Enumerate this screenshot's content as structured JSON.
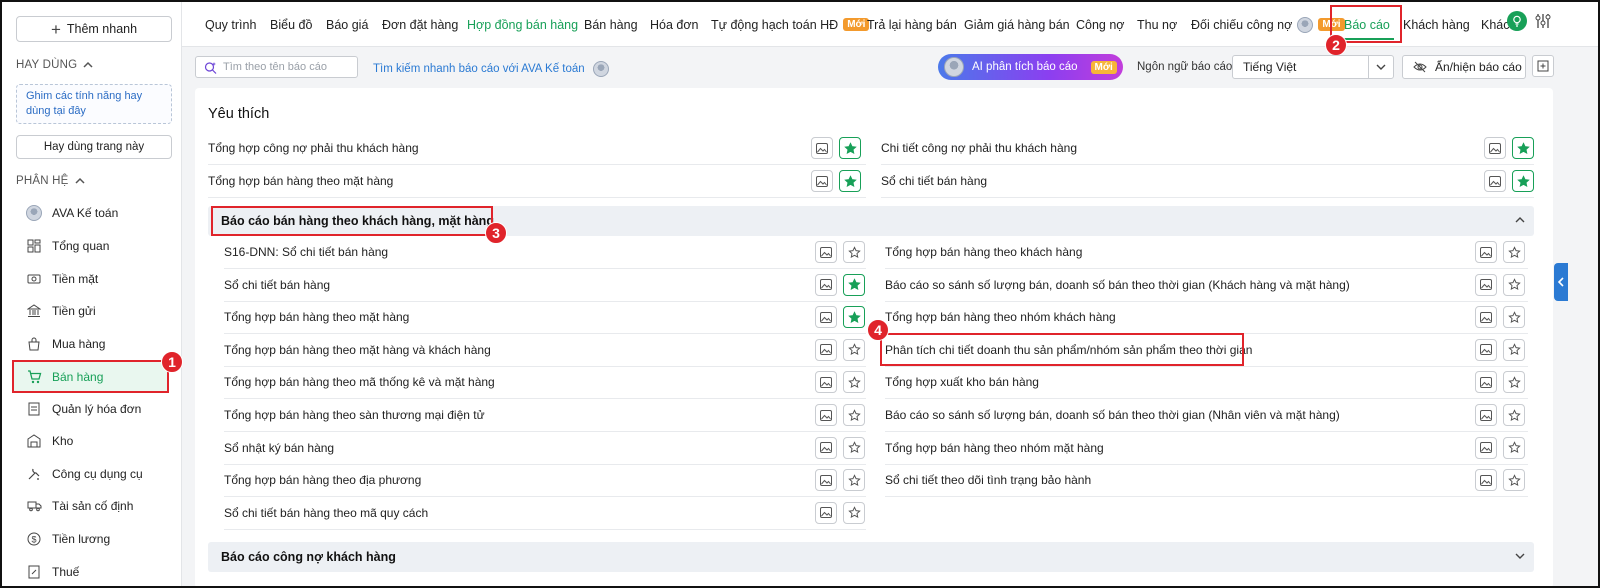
{
  "sidebar": {
    "quick_add_label": "Thêm nhanh",
    "frequent_section": "HAY DÙNG",
    "pin_hint": "Ghim các tính năng hay dùng tại đây",
    "use_page_label": "Hay dùng trang này",
    "modules_section": "PHÂN HỆ",
    "items": [
      {
        "label": "AVA Kế toán",
        "icon": "ava-avatar-icon"
      },
      {
        "label": "Tổng quan",
        "icon": "dashboard-icon"
      },
      {
        "label": "Tiền mặt",
        "icon": "cash-icon"
      },
      {
        "label": "Tiền gửi",
        "icon": "bank-icon"
      },
      {
        "label": "Mua hàng",
        "icon": "shopping-bag-icon"
      },
      {
        "label": "Bán hàng",
        "icon": "cart-icon",
        "active": true
      },
      {
        "label": "Quản lý hóa đơn",
        "icon": "invoice-icon"
      },
      {
        "label": "Kho",
        "icon": "warehouse-icon"
      },
      {
        "label": "Công cụ dụng cụ",
        "icon": "tools-icon"
      },
      {
        "label": "Tài sản cố định",
        "icon": "truck-icon"
      },
      {
        "label": "Tiền lương",
        "icon": "salary-icon"
      },
      {
        "label": "Thuế",
        "icon": "tax-icon"
      }
    ]
  },
  "topnav": {
    "items": [
      "Quy trình",
      "Biểu đồ",
      "Báo giá",
      "Đơn đặt hàng",
      "Hợp đồng bán hàng",
      "Bán hàng",
      "Hóa đơn",
      "Tự động hạch toán HĐ",
      "Trả lại hàng bán",
      "Giảm giá hàng bán",
      "Công nợ",
      "Thu nợ",
      "Đối chiếu công nợ",
      "Báo cáo",
      "Khách hàng",
      "Khác"
    ],
    "new_badge": "Mới",
    "active": "Báo cáo"
  },
  "toolbar": {
    "search_placeholder": "Tìm theo tên báo cáo",
    "ava_search": "Tìm kiếm nhanh báo cáo với AVA Kế toán",
    "ai_analyze": "AI phân tích báo cáo",
    "ai_badge": "Mới",
    "lang_label": "Ngôn ngữ báo cáo",
    "lang_value": "Tiếng Việt",
    "toggle_label": "Ẩn/hiện báo cáo"
  },
  "favorites": {
    "title": "Yêu thích",
    "left": [
      "Tổng hợp công nợ phải thu khách hàng",
      "Tổng hợp bán hàng theo mặt hàng"
    ],
    "right": [
      "Chi tiết công nợ phải thu khách hàng",
      "Sổ chi tiết bán hàng"
    ]
  },
  "group1": {
    "title": "Báo cáo bán hàng theo khách hàng, mặt hàng",
    "left": [
      {
        "label": "S16-DNN: Sổ chi tiết bán hàng",
        "starred": false
      },
      {
        "label": "Sổ chi tiết bán hàng",
        "starred": true
      },
      {
        "label": "Tổng hợp bán hàng theo mặt hàng",
        "starred": true
      },
      {
        "label": "Tổng hợp bán hàng theo mặt hàng và khách hàng",
        "starred": false
      },
      {
        "label": "Tổng hợp bán hàng theo mã thống kê và mặt hàng",
        "starred": false
      },
      {
        "label": "Tổng hợp bán hàng theo sàn thương mại điện tử",
        "starred": false
      },
      {
        "label": "Sổ nhật ký bán hàng",
        "starred": false
      },
      {
        "label": "Tổng hợp bán hàng theo địa phương",
        "starred": false
      },
      {
        "label": "Sổ chi tiết bán hàng theo mã quy cách",
        "starred": false
      }
    ],
    "right": [
      {
        "label": "Tổng hợp bán hàng theo khách hàng",
        "starred": false
      },
      {
        "label": "Báo cáo so sánh số lượng bán, doanh số bán theo thời gian (Khách hàng và mặt hàng)",
        "starred": false
      },
      {
        "label": "Tổng hợp bán hàng theo nhóm khách hàng",
        "starred": false
      },
      {
        "label": "Phân tích chi tiết doanh thu sản phẩm/nhóm sản phẩm theo thời gian",
        "starred": false
      },
      {
        "label": "Tổng hợp xuất kho bán hàng",
        "starred": false
      },
      {
        "label": "Báo cáo so sánh số lượng bán, doanh số bán theo thời gian (Nhân viên và mặt hàng)",
        "starred": false
      },
      {
        "label": "Tổng hợp bán hàng theo nhóm mặt hàng",
        "starred": false
      },
      {
        "label": "Sổ chi tiết theo dõi tình trạng bảo hành",
        "starred": false
      }
    ]
  },
  "group2": {
    "title": "Báo cáo công nợ khách hàng"
  },
  "annotations": [
    "1",
    "2",
    "3",
    "4"
  ],
  "colors": {
    "accent": "#18a058",
    "highlight": "#e0242b",
    "link": "#2b7ad3"
  }
}
